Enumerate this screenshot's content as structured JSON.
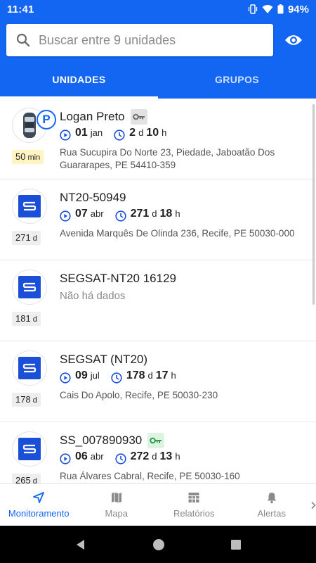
{
  "status_bar": {
    "time": "11:41",
    "battery": "94%"
  },
  "search": {
    "placeholder": "Buscar entre 9 unidades"
  },
  "tabs": [
    {
      "label": "UNIDADES",
      "active": true
    },
    {
      "label": "GRUPOS",
      "active": false
    }
  ],
  "units": [
    {
      "name": "Logan Preto",
      "icon": "car-icon",
      "parking": "P",
      "key_status": "key-off-gray",
      "date_day": "01",
      "date_month": "jan",
      "dur_a": "2",
      "dur_a_unit": "d",
      "dur_b": "10",
      "dur_b_unit": "h",
      "address": "Rua Sucupira Do Norte 23, Piedade, Jaboatão Dos Guararapes, PE 54410-359",
      "badge_value": "50",
      "badge_unit": "min"
    },
    {
      "name": "NT20-50949",
      "icon": "s-logo-icon",
      "date_day": "07",
      "date_month": "abr",
      "dur_a": "271",
      "dur_a_unit": "d",
      "dur_b": "18",
      "dur_b_unit": "h",
      "address": "Avenida Marquês De Olinda 236, Recife, PE 50030-000",
      "badge_value": "271",
      "badge_unit": "d"
    },
    {
      "name": "SEGSAT-NT20 16129",
      "icon": "s-logo-icon",
      "no_data": "Não há dados",
      "badge_value": "181",
      "badge_unit": "d"
    },
    {
      "name": "SEGSAT (NT20)",
      "icon": "s-logo-icon",
      "date_day": "09",
      "date_month": "jul",
      "dur_a": "178",
      "dur_a_unit": "d",
      "dur_b": "17",
      "dur_b_unit": "h",
      "address": "Cais Do Apolo, Recife, PE 50030-230",
      "badge_value": "178",
      "badge_unit": "d"
    },
    {
      "name": "SS_007890930",
      "icon": "s-logo-icon",
      "key_status": "key-on-green",
      "date_day": "06",
      "date_month": "abr",
      "dur_a": "272",
      "dur_a_unit": "d",
      "dur_b": "13",
      "dur_b_unit": "h",
      "address": "Rua Álvares Cabral, Recife, PE 50030-160",
      "badge_value": "265",
      "badge_unit": "d"
    }
  ],
  "bottom_nav": [
    {
      "label": "Monitoramento",
      "icon": "navigation-arrow-icon",
      "active": true
    },
    {
      "label": "Mapa",
      "icon": "map-icon",
      "active": false
    },
    {
      "label": "Relatórios",
      "icon": "table-icon",
      "active": false
    },
    {
      "label": "Alertas",
      "icon": "bell-icon",
      "active": false
    }
  ],
  "colors": {
    "primary": "#1266f1",
    "logo_blue": "#1c4fd7",
    "key_green": "#2e9e48"
  }
}
